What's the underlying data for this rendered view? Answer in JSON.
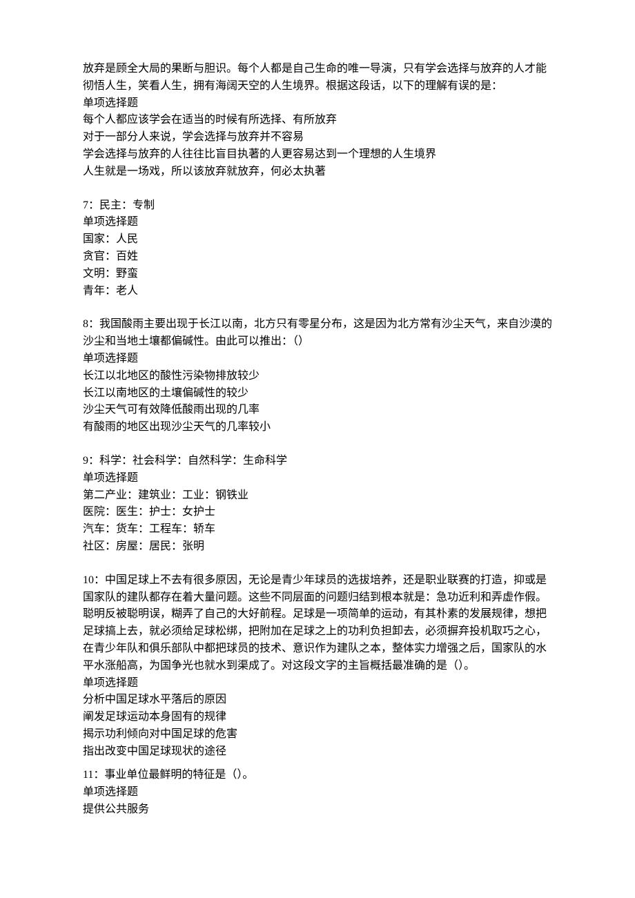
{
  "q6": {
    "stem1": "放弃是顾全大局的果断与胆识。每个人都是自己生命的唯一导演，只有学会选择与放弃的人才能",
    "stem2": "彻悟人生，笑看人生，拥有海阔天空的人生境界。根据这段话，以下的理解有误的是：",
    "type": "单项选择题",
    "opts": [
      "每个人都应该学会在适当的时候有所选择、有所放弃",
      "对于一部分人来说，学会选择与放弃并不容易",
      "学会选择与放弃的人往往比盲目执著的人更容易达到一个理想的人生境界",
      "人生就是一场戏，所以该放弃就放弃，何必太执著"
    ]
  },
  "q7": {
    "stem": "7：民主：专制",
    "type": "单项选择题",
    "opts": [
      "国家：人民",
      "贪官：百姓",
      "文明：野蛮",
      "青年：老人"
    ]
  },
  "q8": {
    "stem1": "8：我国酸雨主要出现于长江以南，北方只有零星分布，这是因为北方常有沙尘天气，来自沙漠的",
    "stem2": "沙尘和当地土壤都偏碱性。由此可以推出：（）",
    "type": "单项选择题",
    "opts": [
      "长江以北地区的酸性污染物排放较少",
      "长江以南地区的土壤偏碱性的较少",
      "沙尘天气可有效降低酸雨出现的几率",
      "有酸雨的地区出现沙尘天气的几率较小"
    ]
  },
  "q9": {
    "stem": "9：科学：社会科学：自然科学：生命科学",
    "type": "单项选择题",
    "opts": [
      "第二产业：建筑业：工业：钢铁业",
      "医院：医生：护士：女护士",
      "汽车：货车：工程车：轿车",
      "社区：房屋：居民：张明"
    ]
  },
  "q10": {
    "stem1": "10：中国足球上不去有很多原因，无论是青少年球员的选拔培养，还是职业联赛的打造，抑或是",
    "stem2": "国家队的建队都存在着大量问题。这些不同层面的问题归结到根本就是：急功近利和弄虚作假。",
    "stem3": "聪明反被聪明误，糊弄了自己的大好前程。足球是一项简单的运动，有其朴素的发展规律，想把",
    "stem4": "足球搞上去，就必须给足球松绑，把附加在足球之上的功利负担卸去，必须摒弃投机取巧之心，",
    "stem5": "在青少年队和俱乐部队中都把球员的技术、意识作为建队之本，整体实力增强之后，国家队的水",
    "stem6": "平水涨船高，为国争光也就水到渠成了。对这段文字的主旨概括最准确的是（）。",
    "type": "单项选择题",
    "opts": [
      "分析中国足球水平落后的原因",
      "阐发足球运动本身固有的规律",
      "揭示功利倾向对中国足球的危害",
      "指出改变中国足球现状的途径"
    ]
  },
  "q11": {
    "stem": "11：事业单位最鲜明的特征是（）。",
    "type": "单项选择题",
    "opts": [
      "提供公共服务"
    ]
  }
}
